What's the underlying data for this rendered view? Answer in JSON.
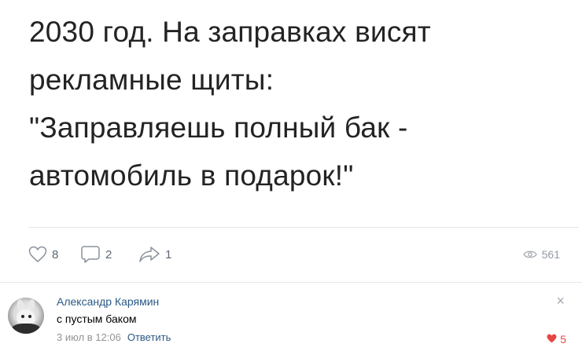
{
  "post": {
    "lines": [
      "2030 год. На заправках висят",
      "рекламные щиты:",
      "\"Заправляешь полный бак -",
      "автомобиль в подарок!\""
    ]
  },
  "actions": {
    "likes": "8",
    "comments": "2",
    "shares": "1",
    "views": "561",
    "icon_color": "#6e7782"
  },
  "comment": {
    "author": "Александр Карямин",
    "text": "с пустым баком",
    "date": "3 июл в 12:06",
    "reply_label": "Ответить",
    "likes": "5",
    "close_icon": "×",
    "author_color": "#2a5885",
    "like_color": "#e64646"
  }
}
